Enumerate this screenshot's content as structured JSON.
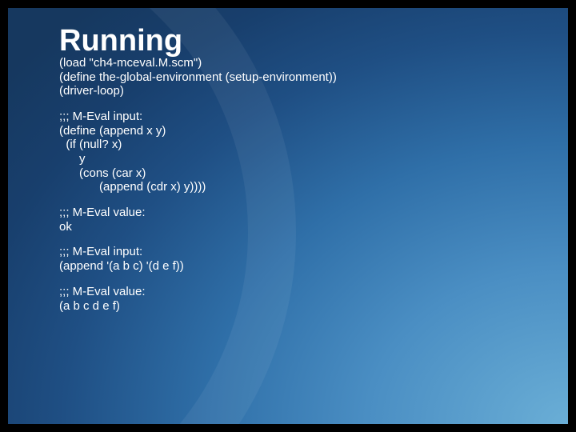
{
  "title": "Running",
  "blocks": {
    "b0": "(load \"ch4-mceval.M.scm\")\n(define the-global-environment (setup-environment))\n(driver-loop)",
    "b1": ";;; M-Eval input:\n(define (append x y)\n  (if (null? x)\n      y\n      (cons (car x)\n            (append (cdr x) y))))",
    "b2": ";;; M-Eval value:\nok",
    "b3": ";;; M-Eval input:\n(append '(a b c) '(d e f))",
    "b4": ";;; M-Eval value:\n(a b c d e f)"
  }
}
